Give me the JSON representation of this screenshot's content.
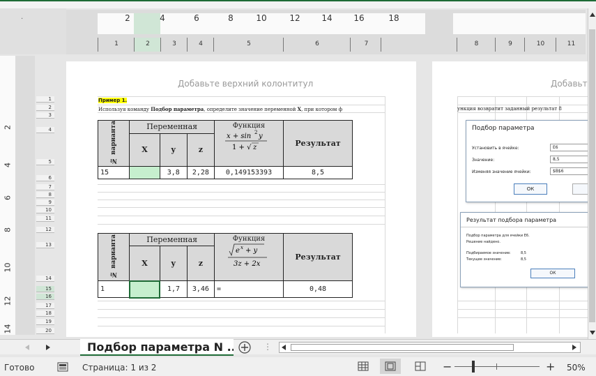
{
  "header_placeholder": "Добавьте верхний колонтитул",
  "header_placeholder_right": "Добавьте",
  "top_ruler": {
    "numbers": [
      "2",
      "4",
      "6",
      "8",
      "10",
      "12",
      "14",
      "16",
      "18"
    ],
    "columns": [
      "1",
      "2",
      "3",
      "4",
      "5",
      "6",
      "7",
      "8",
      "9",
      "10",
      "11"
    ]
  },
  "left_ruler": {
    "numbers": [
      "2",
      "4",
      "6",
      "8",
      "10",
      "12",
      "14"
    ],
    "rows": [
      "1",
      "2",
      "3",
      "4",
      "5",
      "6",
      "7",
      "8",
      "9",
      "10",
      "11",
      "12",
      "13",
      "14",
      "15",
      "16",
      "17",
      "18",
      "19",
      "20"
    ]
  },
  "sheet": {
    "example_label": "Пример 1.",
    "description_pre": "Используя команду ",
    "description_bold1": "Подбор параметра",
    "description_mid": ", определите значение переменной ",
    "description_bold2": "X",
    "description_post": ", при котором ф",
    "description_continued": "ункция возвратит заданный результат 8",
    "table1": {
      "col_variant": "№ варианта",
      "col_variable": "Переменная",
      "col_function": "Функция",
      "col_result": "Результат",
      "sub_x": "X",
      "sub_y": "y",
      "sub_z": "z",
      "row": {
        "variant": "15",
        "x": "",
        "y": "3,8",
        "z": "2,28",
        "function": "0,149153393",
        "result": "8,5"
      }
    },
    "table2": {
      "col_variant": "№ варианта",
      "col_variable": "Переменная",
      "col_function": "Функция",
      "col_result": "Результат",
      "sub_x": "X",
      "sub_y": "y",
      "sub_z": "z",
      "row": {
        "variant": "1",
        "x": "",
        "y": "1,7",
        "z": "3,46",
        "function": "=",
        "result": "0,48"
      }
    }
  },
  "goal_seek_dialog": {
    "title": "Подбор параметра",
    "set_cell_label": "Установить в ячейке:",
    "set_cell_value": "E6",
    "value_label": "Значение:",
    "value_value": "8,5",
    "changing_cell_label": "Изменяя значение ячейки:",
    "changing_cell_value": "$B$6",
    "ok": "ОК"
  },
  "goal_seek_result": {
    "title": "Результат подбора параметра",
    "line1": "Подбор параметра для ячейки E6.",
    "line2": "Решение найдено.",
    "target_label": "Подбираемое значение:",
    "target_value": "8,5",
    "current_label": "Текущее значение:",
    "current_value": "8,5",
    "ok": "ОК"
  },
  "tabs": {
    "active_sheet": "Подбор параметра N ...",
    "add_icon": "plus-circle-icon",
    "prev_icon": "chevron-left-icon",
    "next_icon": "chevron-right-icon"
  },
  "status": {
    "ready": "Готово",
    "page": "Страница: 1 из 2",
    "zoom": "50%",
    "zoom_level": 0.5,
    "minus": "−",
    "plus": "+"
  },
  "colors": {
    "accent": "#1e6b36",
    "highlight": "#ffff00",
    "cell_green": "#c6efce",
    "header_gray": "#d9d9d9"
  }
}
